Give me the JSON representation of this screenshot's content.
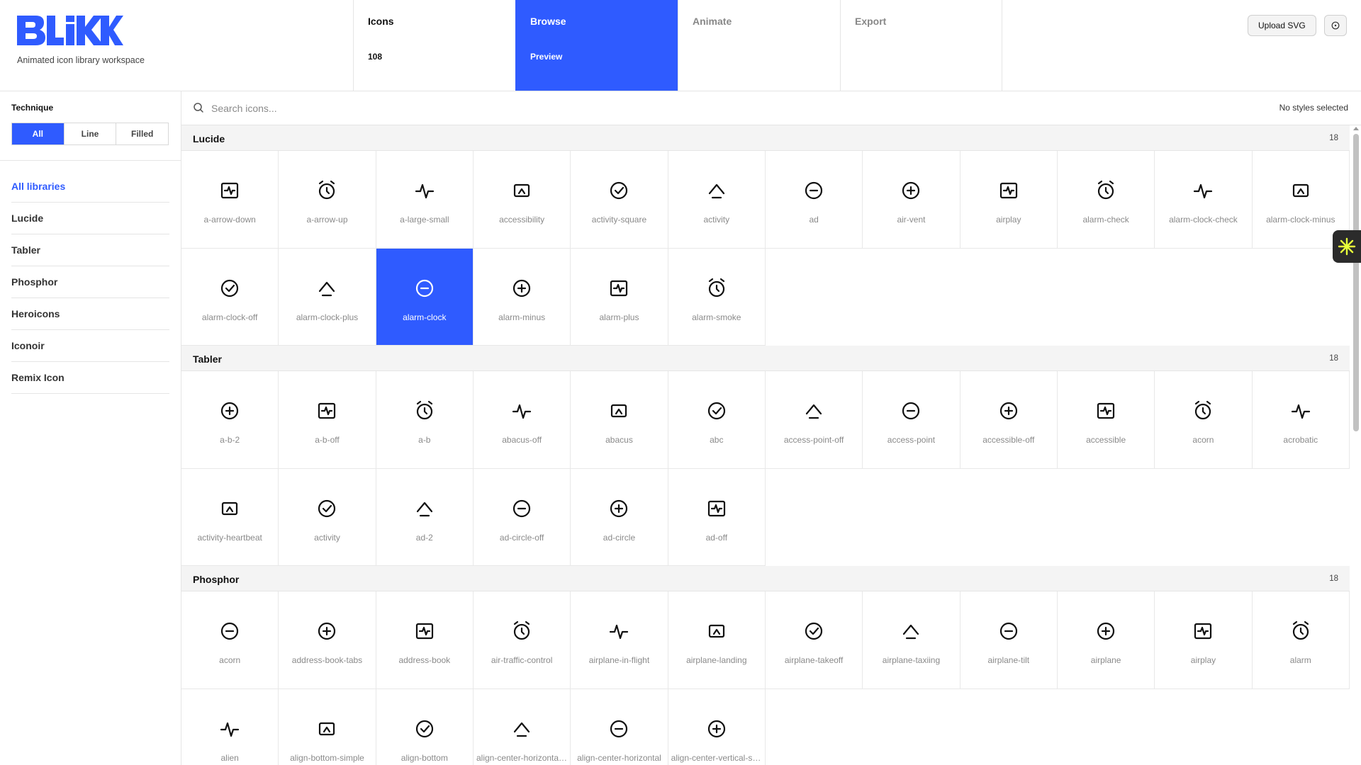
{
  "app": {
    "logo_text": "BLIKK",
    "tagline": "Animated icon library workspace",
    "accent": "#2f5bff"
  },
  "steps": [
    {
      "title": "Icons",
      "subtitle": "108",
      "state": "done"
    },
    {
      "title": "Browse",
      "subtitle": "Preview",
      "state": "active"
    },
    {
      "title": "Animate",
      "subtitle": "",
      "state": "muted"
    },
    {
      "title": "Export",
      "subtitle": "",
      "state": "muted"
    }
  ],
  "header": {
    "upload_label": "Upload SVG",
    "help_icon": "help-circle-icon"
  },
  "sidebar": {
    "technique_label": "Technique",
    "technique_options": [
      "All",
      "Line",
      "Filled"
    ],
    "technique_selected": "All",
    "libraries": [
      "All libraries",
      "Lucide",
      "Tabler",
      "Phosphor",
      "Heroicons",
      "Iconoir",
      "Remix Icon"
    ],
    "library_selected": "All libraries"
  },
  "search": {
    "placeholder": "Search icons...",
    "value": "",
    "styles_note": "No styles selected"
  },
  "sections": [
    {
      "title": "Lucide",
      "count": "18",
      "icons": [
        "a-arrow-down",
        "a-arrow-up",
        "a-large-small",
        "accessibility",
        "activity-square",
        "activity",
        "ad",
        "air-vent",
        "airplay",
        "alarm-check",
        "alarm-clock-check",
        "alarm-clock-minus",
        "alarm-clock-off",
        "alarm-clock-plus",
        "alarm-clock",
        "alarm-minus",
        "alarm-plus",
        "alarm-smoke"
      ],
      "selected": "alarm-clock"
    },
    {
      "title": "Tabler",
      "count": "18",
      "icons": [
        "a-b-2",
        "a-b-off",
        "a-b",
        "abacus-off",
        "abacus",
        "abc",
        "access-point-off",
        "access-point",
        "accessible-off",
        "accessible",
        "acorn",
        "acrobatic",
        "activity-heartbeat",
        "activity",
        "ad-2",
        "ad-circle-off",
        "ad-circle",
        "ad-off"
      ]
    },
    {
      "title": "Phosphor",
      "count": "18",
      "icons": [
        "acorn",
        "address-book-tabs",
        "address-book",
        "air-traffic-control",
        "airplane-in-flight",
        "airplane-landing",
        "airplane-takeoff",
        "airplane-taxiing",
        "airplane-tilt",
        "airplane",
        "airplay",
        "alarm",
        "alien",
        "align-bottom-simple",
        "align-bottom",
        "align-center-horizontal-simple",
        "align-center-horizontal",
        "align-center-vertical-simple"
      ]
    }
  ]
}
